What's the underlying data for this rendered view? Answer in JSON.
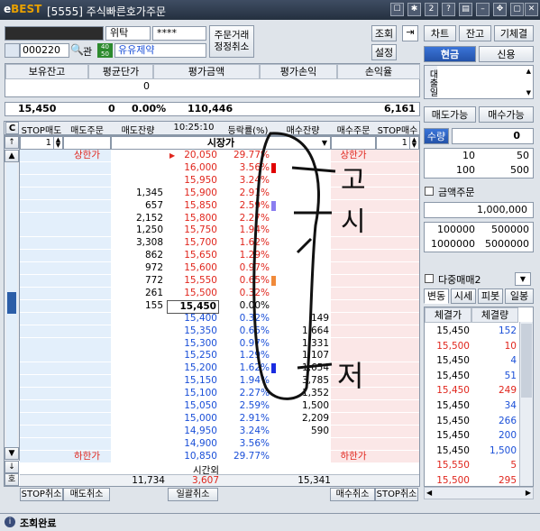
{
  "window": {
    "logo_main": "e",
    "logo_brand": "BEST",
    "title": "[5555] 주식빠른호가주문"
  },
  "account": {
    "number_masked": "",
    "name": "위탁",
    "password": "****",
    "code": "000220",
    "item_name": "유유제약",
    "tag_top": "40",
    "tag_bot": "50",
    "gwan": "관"
  },
  "top_buttons": {
    "order_multi": "주문거래",
    "cancel_all": "정정취소",
    "inquiry": "조회",
    "settings": "설정"
  },
  "holding": {
    "headers": [
      "보유잔고",
      "평균단가",
      "평가금액",
      "평가손익",
      "손익율"
    ],
    "values": [
      "",
      "0",
      "",
      "",
      ""
    ]
  },
  "summary": {
    "price": "15,450",
    "zero": "0",
    "rate": "0.00%",
    "amount": "110,446",
    "right": "6,161"
  },
  "right_panel": {
    "chart": "차트",
    "balance": "잔고",
    "contracted": "기체결",
    "cash": "현금",
    "credit": "신용",
    "loan_label": "대출일",
    "sell_able": "매도가능",
    "buy_able": "매수가능",
    "qty_label": "수량",
    "qty_value": "0",
    "qty_presets": [
      [
        "10",
        "50"
      ],
      [
        "100",
        "500"
      ]
    ],
    "amount_order": "금액주문",
    "amount_value": "1,000,000",
    "amount_presets": [
      [
        "100000",
        "500000"
      ],
      [
        "1000000",
        "5000000"
      ]
    ],
    "multi_trade": "다중매매2",
    "tabs": [
      "변동",
      "시세",
      "피봇",
      "일봉"
    ],
    "trades_headers": [
      "체결가",
      "체결량"
    ],
    "trades": [
      {
        "p": "15,450",
        "q": "152",
        "c": "blue"
      },
      {
        "p": "15,500",
        "q": "10",
        "c": "red"
      },
      {
        "p": "15,450",
        "q": "4",
        "c": "blue"
      },
      {
        "p": "15,450",
        "q": "51",
        "c": "blue"
      },
      {
        "p": "15,450",
        "q": "249",
        "c": "red"
      },
      {
        "p": "15,450",
        "q": "34",
        "c": "blue"
      },
      {
        "p": "15,450",
        "q": "266",
        "c": "blue"
      },
      {
        "p": "15,450",
        "q": "200",
        "c": "blue"
      },
      {
        "p": "15,450",
        "q": "1,500",
        "c": "blue"
      },
      {
        "p": "15,550",
        "q": "5",
        "c": "red"
      },
      {
        "p": "15,500",
        "q": "295",
        "c": "red"
      }
    ]
  },
  "grid": {
    "headers": [
      "STOP매도",
      "매도주문",
      "매도잔량",
      "10:25:10",
      "등락률(%)",
      "매수잔량",
      "매수주문",
      "STOP매수"
    ],
    "qty_left": "1",
    "qty_right": "1",
    "market": "시장가",
    "sangga": "상한가",
    "hahan": "하한가",
    "after_hours": "시간외",
    "rows": [
      {
        "price": "20,050",
        "pct": "29.77%",
        "sell": "",
        "buy": "",
        "pc": "red",
        "lmark": "상한가",
        "rmark": "상한가",
        "bar": ""
      },
      {
        "price": "16,000",
        "pct": "3.56%",
        "sell": "",
        "buy": "",
        "pc": "red",
        "bar": "#e00000"
      },
      {
        "price": "15,950",
        "pct": "3.24%",
        "sell": "",
        "buy": "",
        "pc": "red",
        "bar": ""
      },
      {
        "price": "15,900",
        "pct": "2.91%",
        "sell": "1,345",
        "buy": "",
        "pc": "red",
        "bar": ""
      },
      {
        "price": "15,850",
        "pct": "2.59%",
        "sell": "657",
        "buy": "",
        "pc": "red",
        "bar": "#8a7ef0"
      },
      {
        "price": "15,800",
        "pct": "2.27%",
        "sell": "2,152",
        "buy": "",
        "pc": "red",
        "bar": ""
      },
      {
        "price": "15,750",
        "pct": "1.94%",
        "sell": "1,250",
        "buy": "",
        "pc": "red",
        "bar": ""
      },
      {
        "price": "15,700",
        "pct": "1.62%",
        "sell": "3,308",
        "buy": "",
        "pc": "red",
        "bar": ""
      },
      {
        "price": "15,650",
        "pct": "1.29%",
        "sell": "862",
        "buy": "",
        "pc": "red",
        "bar": ""
      },
      {
        "price": "15,600",
        "pct": "0.97%",
        "sell": "972",
        "buy": "",
        "pc": "red",
        "bar": ""
      },
      {
        "price": "15,550",
        "pct": "0.65%",
        "sell": "772",
        "buy": "",
        "pc": "red",
        "bar": "#f08a3a"
      },
      {
        "price": "15,500",
        "pct": "0.32%",
        "sell": "261",
        "buy": "",
        "pc": "red",
        "bar": ""
      },
      {
        "price": "15,450",
        "pct": "0.00%",
        "sell": "155",
        "buy": "",
        "pc": "black",
        "bar": ""
      },
      {
        "price": "15,400",
        "pct": "0.32%",
        "sell": "",
        "buy": "149",
        "pc": "blue",
        "bar": ""
      },
      {
        "price": "15,350",
        "pct": "0.65%",
        "sell": "",
        "buy": "1,664",
        "pc": "blue",
        "bar": ""
      },
      {
        "price": "15,300",
        "pct": "0.97%",
        "sell": "",
        "buy": "1,331",
        "pc": "blue",
        "bar": ""
      },
      {
        "price": "15,250",
        "pct": "1.29%",
        "sell": "",
        "buy": "1,107",
        "pc": "blue",
        "bar": ""
      },
      {
        "price": "15,200",
        "pct": "1.62%",
        "sell": "",
        "buy": "1,654",
        "pc": "blue",
        "bar": "#1a2ce0"
      },
      {
        "price": "15,150",
        "pct": "1.94%",
        "sell": "",
        "buy": "3,785",
        "pc": "blue",
        "bar": ""
      },
      {
        "price": "15,100",
        "pct": "2.27%",
        "sell": "",
        "buy": "1,352",
        "pc": "blue",
        "bar": ""
      },
      {
        "price": "15,050",
        "pct": "2.59%",
        "sell": "",
        "buy": "1,500",
        "pc": "blue",
        "bar": ""
      },
      {
        "price": "15,000",
        "pct": "2.91%",
        "sell": "",
        "buy": "2,209",
        "pc": "blue",
        "bar": ""
      },
      {
        "price": "14,950",
        "pct": "3.24%",
        "sell": "",
        "buy": "590",
        "pc": "blue",
        "bar": ""
      },
      {
        "price": "14,900",
        "pct": "3.56%",
        "sell": "",
        "buy": "",
        "pc": "blue",
        "bar": ""
      },
      {
        "price": "10,850",
        "pct": "29.77%",
        "sell": "",
        "buy": "",
        "pc": "blue",
        "lmark": "하한가",
        "rmark": "하한가",
        "bar": ""
      }
    ],
    "totals": {
      "sell": "11,734",
      "diff": "3,607",
      "buy": "15,341"
    }
  },
  "bottom_buttons": [
    "STOP취소",
    "매도취소",
    "일괄취소",
    "매수취소",
    "STOP취소"
  ],
  "annotations": {
    "top1": "고",
    "top2": "시",
    "bottom": "저"
  },
  "status": {
    "text": "조회완료"
  },
  "colors": {
    "up": "#e0261d",
    "down": "#1a4fd8",
    "ask_bg": "#e3effb",
    "bid_bg": "#fbe7e7"
  }
}
